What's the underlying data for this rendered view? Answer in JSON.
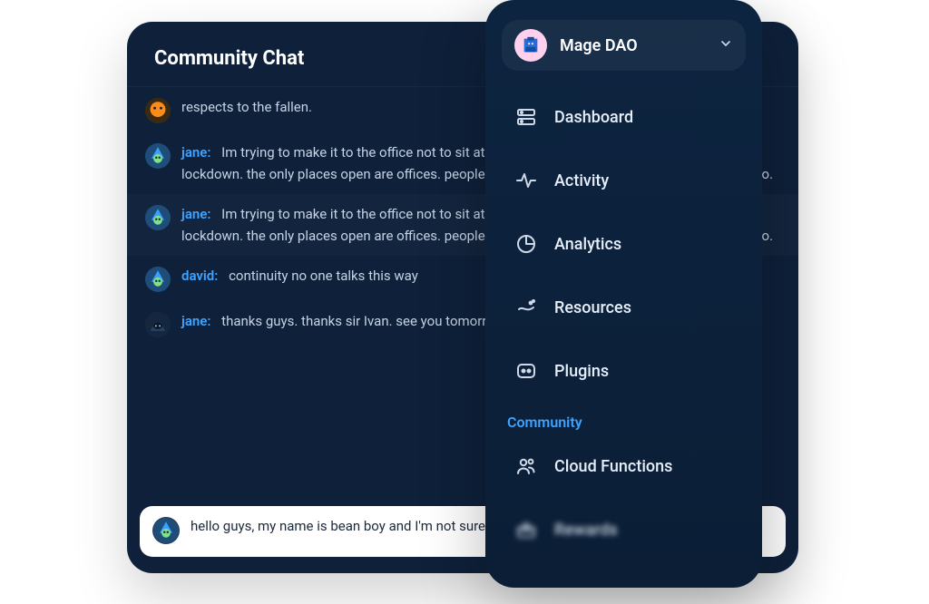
{
  "chat": {
    "title": "Community Chat",
    "messages": [
      {
        "author": "",
        "text": "respects to the fallen.",
        "avatar": "orange"
      },
      {
        "author": "jane:",
        "text": "Im trying to make it to the office not to sit at home all day. 'liv long' is a waste of life during lockdown. the only places open are offices. people in offices are much mnore interesting to talk to.",
        "avatar": "mage"
      },
      {
        "author": "jane:",
        "text": "Im trying to make it to the office not to sit at home all day. 'liv long' is a waste of life during lockdown. the only places open are offices. people in offices are much mnore interesting to talk to.",
        "avatar": "mage",
        "alt": true
      },
      {
        "author": "david:",
        "text": "continuity no one talks this way",
        "avatar": "mage"
      },
      {
        "author": "jane:",
        "text": "thanks guys. thanks sir Ivan. see you tomorrow good night. have anice day everyone",
        "avatar": "hood"
      }
    ],
    "composer_value": "hello guys, my name is bean boy and I'm not sure what I should type in|"
  },
  "sidebar": {
    "workspace": {
      "name": "Mage DAO"
    },
    "nav": [
      {
        "label": "Dashboard",
        "icon": "dashboard"
      },
      {
        "label": "Activity",
        "icon": "activity"
      },
      {
        "label": "Analytics",
        "icon": "analytics"
      },
      {
        "label": "Resources",
        "icon": "resources"
      },
      {
        "label": "Plugins",
        "icon": "plugins"
      }
    ],
    "community_label": "Community",
    "community": [
      {
        "label": "Cloud Functions",
        "icon": "people"
      },
      {
        "label": "Rewards",
        "icon": "rewards",
        "blurred": true
      }
    ]
  }
}
